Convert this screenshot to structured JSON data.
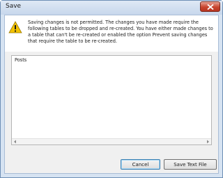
{
  "window": {
    "title": "Save"
  },
  "message": {
    "text": "Saving changes is not permitted. The changes you have made require the following tables to be dropped and re-created. You have either made changes to a table that can't be re-created or enabled the option Prevent saving changes that require the table to be re-created."
  },
  "details": {
    "text": "Posts"
  },
  "buttons": {
    "cancel": "Cancel",
    "save_text_file": "Save Text File"
  },
  "colors": {
    "warning": "#f2c200",
    "close_button": "#c8452f",
    "titlebar": "#c7d7ec"
  }
}
